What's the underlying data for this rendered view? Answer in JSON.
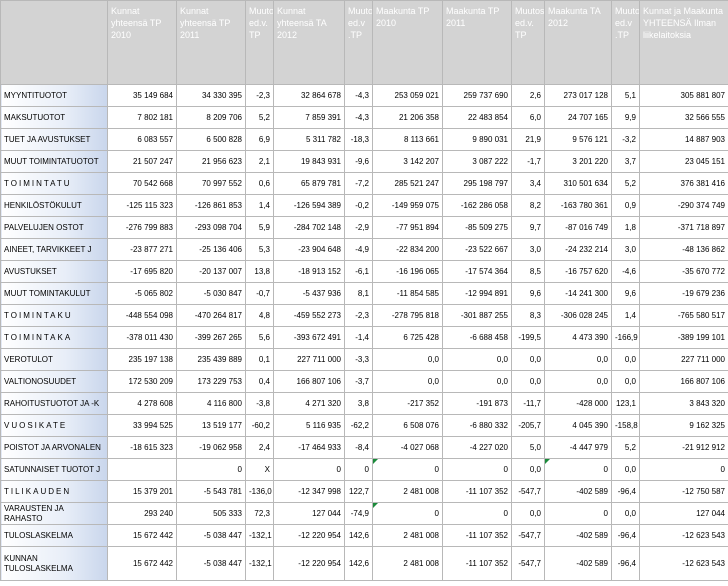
{
  "headers": [
    "",
    "Kunnat yhteensä TP 2010",
    "Kunnat yhteensä TP 2011",
    "Muutos ed.v. TP",
    "Kunnat yhteensä TA 2012",
    "Muutos ed.v .TP",
    "Maakunta TP 2010",
    "Maakunta TP 2011",
    "Muutos ed.v. TP",
    "Maakunta TA 2012",
    "Muutos ed.v .TP",
    "Kunnat ja Maakunta YHTEENSÄ Ilman liikelaitoksia"
  ],
  "rows": [
    {
      "label": "MYYNTITUOTOT",
      "cells": [
        "35 149 684",
        "34 330 395",
        "-2,3",
        "32 864 678",
        "-4,3",
        "253 059 021",
        "259 737 690",
        "2,6",
        "273 017 128",
        "5,1",
        "305 881 807"
      ]
    },
    {
      "label": "MAKSUTUOTOT",
      "cells": [
        "7 802 181",
        "8 209 706",
        "5,2",
        "7 859 391",
        "-4,3",
        "21 206 358",
        "22 483 854",
        "6,0",
        "24 707 165",
        "9,9",
        "32 566 555"
      ]
    },
    {
      "label": "TUET JA AVUSTUKSET",
      "cells": [
        "6 083 557",
        "6 500 828",
        "6,9",
        "5 311 782",
        "-18,3",
        "8 113 661",
        "9 890 031",
        "21,9",
        "9 576 121",
        "-3,2",
        "14 887 903"
      ]
    },
    {
      "label": "MUUT TOIMINTATUOTOT",
      "cells": [
        "21 507 247",
        "21 956 623",
        "2,1",
        "19 843 931",
        "-9,6",
        "3 142 207",
        "3 087 222",
        "-1,7",
        "3 201 220",
        "3,7",
        "23 045 151"
      ]
    },
    {
      "label": "TOIMINTATU",
      "spaced": true,
      "cells": [
        "70 542 668",
        "70 997 552",
        "0,6",
        "65 879 781",
        "-7,2",
        "285 521 247",
        "295 198 797",
        "3,4",
        "310 501 634",
        "5,2",
        "376 381 416"
      ]
    },
    {
      "label": "HENKILÖSTÖKULUT",
      "cells": [
        "-125 115 323",
        "-126 861 853",
        "1,4",
        "-126 594 389",
        "-0,2",
        "-149 959 075",
        "-162 286 058",
        "8,2",
        "-163 780 361",
        "0,9",
        "-290 374 749"
      ]
    },
    {
      "label": "PALVELUJEN OSTOT",
      "cells": [
        "-276 799 883",
        "-293 098 704",
        "5,9",
        "-284 702 148",
        "-2,9",
        "-77 951 894",
        "-85 509 275",
        "9,7",
        "-87 016 749",
        "1,8",
        "-371 718 897"
      ]
    },
    {
      "label": "AINEET, TARVIKKEET J",
      "cells": [
        "-23 877 271",
        "-25 136 406",
        "5,3",
        "-23 904 648",
        "-4,9",
        "-22 834 200",
        "-23 522 667",
        "3,0",
        "-24 232 214",
        "3,0",
        "-48 136 862"
      ]
    },
    {
      "label": "AVUSTUKSET",
      "cells": [
        "-17 695 820",
        "-20 137 007",
        "13,8",
        "-18 913 152",
        "-6,1",
        "-16 196 065",
        "-17 574 364",
        "8,5",
        "-16 757 620",
        "-4,6",
        "-35 670 772"
      ]
    },
    {
      "label": "MUUT TOMINTAKULUT",
      "cells": [
        "-5 065 802",
        "-5 030 847",
        "-0,7",
        "-5 437 936",
        "8,1",
        "-11 854 585",
        "-12 994 891",
        "9,6",
        "-14 241 300",
        "9,6",
        "-19 679 236"
      ]
    },
    {
      "label": "TOIMINTAKU",
      "spaced": true,
      "cells": [
        "-448 554 098",
        "-470 264 817",
        "4,8",
        "-459 552 273",
        "-2,3",
        "-278 795 818",
        "-301 887 255",
        "8,3",
        "-306 028 245",
        "1,4",
        "-765 580 517"
      ]
    },
    {
      "label": "TOIMINTAKA",
      "spaced": true,
      "cells": [
        "-378 011 430",
        "-399 267 265",
        "5,6",
        "-393 672 491",
        "-1,4",
        "6 725 428",
        "-6 688 458",
        "-199,5",
        "4 473 390",
        "-166,9",
        "-389 199 101"
      ]
    },
    {
      "label": "VEROTULOT",
      "cells": [
        "235 197 138",
        "235 439 889",
        "0,1",
        "227 711 000",
        "-3,3",
        "0,0",
        "0,0",
        "0,0",
        "0,0",
        "0,0",
        "227 711 000"
      ]
    },
    {
      "label": "VALTIONOSUUDET",
      "cells": [
        "172 530 209",
        "173 229 753",
        "0,4",
        "166 807 106",
        "-3,7",
        "0,0",
        "0,0",
        "0,0",
        "0,0",
        "0,0",
        "166 807 106"
      ]
    },
    {
      "label": "RAHOITUSTUOTOT JA -K",
      "cells": [
        "4 278 608",
        "4 116 800",
        "-3,8",
        "4 271 320",
        "3,8",
        "-217 352",
        "-191 873",
        "-11,7",
        "-428 000",
        "123,1",
        "3 843 320"
      ]
    },
    {
      "label": "VUOSIKATE",
      "spaced": true,
      "cells": [
        "33 994 525",
        "13 519 177",
        "-60,2",
        "5 116 935",
        "-62,2",
        "6 508 076",
        "-6 880 332",
        "-205,7",
        "4 045 390",
        "-158,8",
        "9 162 325"
      ]
    },
    {
      "label": "POISTOT JA ARVONALEN",
      "cells": [
        "-18 615 323",
        "-19 062 958",
        "2,4",
        "-17 464 933",
        "-8,4",
        "-4 027 068",
        "-4 227 020",
        "5,0",
        "-4 447 979",
        "5,2",
        "-21 912 912"
      ]
    },
    {
      "label": "SATUNNAISET TUOTOT J",
      "cells": [
        "",
        "0",
        "X",
        "0",
        "0",
        "0",
        "0",
        "0,0",
        "0",
        "0,0",
        "0"
      ],
      "flags": [
        5,
        8
      ]
    },
    {
      "label": "TILIKAUDEN",
      "spaced": true,
      "cells": [
        "15 379 201",
        "-5 543 781",
        "-136,0",
        "-12 347 998",
        "122,7",
        "2 481 008",
        "-11 107 352",
        "-547,7",
        "-402 589",
        "-96,4",
        "-12 750 587"
      ]
    },
    {
      "label": "VARAUSTEN JA RAHASTO",
      "cells": [
        "293 240",
        "505 333",
        "72,3",
        "127 044",
        "-74,9",
        "0",
        "0",
        "0,0",
        "0",
        "0,0",
        "127 044"
      ],
      "flags": [
        5
      ]
    },
    {
      "label": "TULOSLASKELMA",
      "cells": [
        "15 672 442",
        "-5 038 447",
        "-132,1",
        "-12 220 954",
        "142,6",
        "2 481 008",
        "-11 107 352",
        "-547,7",
        "-402 589",
        "-96,4",
        "-12 623 543"
      ]
    },
    {
      "label": "KUNNAN TULOSLASKELMA",
      "cells": [
        "15 672 442",
        "-5 038 447",
        "-132,1",
        "-12 220 954",
        "142,6",
        "2 481 008",
        "-11 107 352",
        "-547,7",
        "-402 589",
        "-96,4",
        "-12 623 543"
      ]
    }
  ]
}
